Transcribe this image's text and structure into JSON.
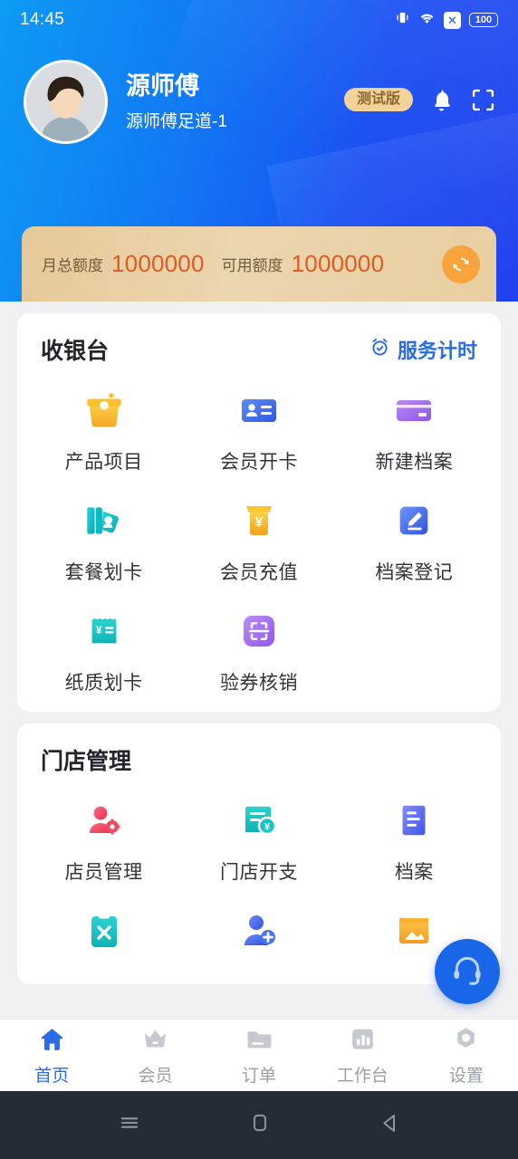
{
  "status_bar": {
    "time": "14:45",
    "battery_level": "100",
    "icons": [
      "vibrate-icon",
      "wifi-icon",
      "no-sim-icon",
      "battery-icon"
    ]
  },
  "header": {
    "user_name": "源师傅",
    "store_name": "源师傅足道-1",
    "beta_badge": "测试版",
    "bell_icon": "bell-icon",
    "scan_icon": "scan-icon",
    "accent_blue": "#1b4ff2"
  },
  "quota": {
    "total_label": "月总额度",
    "total_value": "1000000",
    "available_label": "可用额度",
    "available_value": "1000000",
    "refresh_icon": "refresh-icon",
    "value_color": "#e05b22",
    "card_color": "#e8cfa2"
  },
  "cashier": {
    "title": "收银台",
    "action_label": "服务计时",
    "action_icon": "alarm-clock-icon",
    "items": [
      {
        "label": "产品项目",
        "icon": "basket-icon",
        "color": "#f7b733"
      },
      {
        "label": "会员开卡",
        "icon": "id-card-icon",
        "color": "#3f6fe8"
      },
      {
        "label": "新建档案",
        "icon": "credit-card-icon",
        "color": "#a06ce8"
      },
      {
        "label": "套餐划卡",
        "icon": "cards-swipe-icon",
        "color": "#16bdc8"
      },
      {
        "label": "会员充值",
        "icon": "atm-yuan-icon",
        "color": "#f7b733"
      },
      {
        "label": "档案登记",
        "icon": "pencil-edit-icon",
        "color": "#4a74ec"
      },
      {
        "label": "纸质划卡",
        "icon": "receipt-yuan-icon",
        "color": "#1fc6c0"
      },
      {
        "label": "验券核销",
        "icon": "scan-code-icon",
        "color": "#a96ef0"
      }
    ]
  },
  "store_management": {
    "title": "门店管理",
    "items": [
      {
        "label": "店员管理",
        "icon": "user-gear-icon",
        "color": "#ef4a62"
      },
      {
        "label": "门店开支",
        "icon": "receipt-expense-icon",
        "color": "#19c6c4"
      },
      {
        "label": "档案",
        "icon": "document-lines-icon",
        "color": "#5a6ff0"
      },
      {
        "label": "",
        "icon": "clipboard-x-icon",
        "color": "#17c8c0"
      },
      {
        "label": "",
        "icon": "user-add-icon",
        "color": "#4a74ec"
      },
      {
        "label": "",
        "icon": "image-card-icon",
        "color": "#f9b233"
      }
    ]
  },
  "fab": {
    "icon": "headset-support-icon",
    "color": "#1a66e8"
  },
  "tabbar": {
    "tabs": [
      {
        "label": "首页",
        "icon": "home-icon",
        "active": true
      },
      {
        "label": "会员",
        "icon": "crown-icon",
        "active": false
      },
      {
        "label": "订单",
        "icon": "folder-icon",
        "active": false
      },
      {
        "label": "工作台",
        "icon": "chart-icon",
        "active": false
      },
      {
        "label": "设置",
        "icon": "gear-icon",
        "active": false
      }
    ]
  },
  "android_nav": {
    "recents_icon": "menu-icon",
    "home_icon": "home-square-icon",
    "back_icon": "back-triangle-icon"
  }
}
